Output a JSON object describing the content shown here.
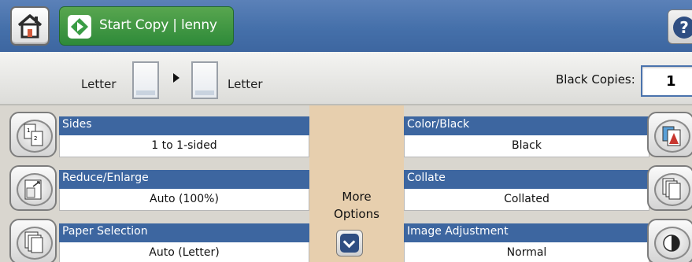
{
  "header": {
    "start_copy_label": "Start Copy | lenny"
  },
  "copy_bar": {
    "original_size": "Letter",
    "output_size": "Letter",
    "copies_label": "Black Copies:",
    "copies_value": "1"
  },
  "options_left": [
    {
      "title": "Sides",
      "value": "1 to 1-sided",
      "icon": "sides-icon"
    },
    {
      "title": "Reduce/Enlarge",
      "value": "Auto (100%)",
      "icon": "reduce-enlarge-icon"
    },
    {
      "title": "Paper Selection",
      "value": "Auto (Letter)",
      "icon": "paper-selection-icon"
    }
  ],
  "options_right": [
    {
      "title": "Color/Black",
      "value": "Black",
      "icon": "color-black-icon"
    },
    {
      "title": "Collate",
      "value": "Collated",
      "icon": "collate-icon"
    },
    {
      "title": "Image Adjustment",
      "value": "Normal",
      "icon": "image-adjustment-icon"
    }
  ],
  "more_options": {
    "line1": "More",
    "line2": "Options"
  },
  "colors": {
    "header_blue": "#4570aa",
    "option_blue": "#3d66a0",
    "start_green": "#2e8a39",
    "more_panel": "#e7cfae"
  }
}
